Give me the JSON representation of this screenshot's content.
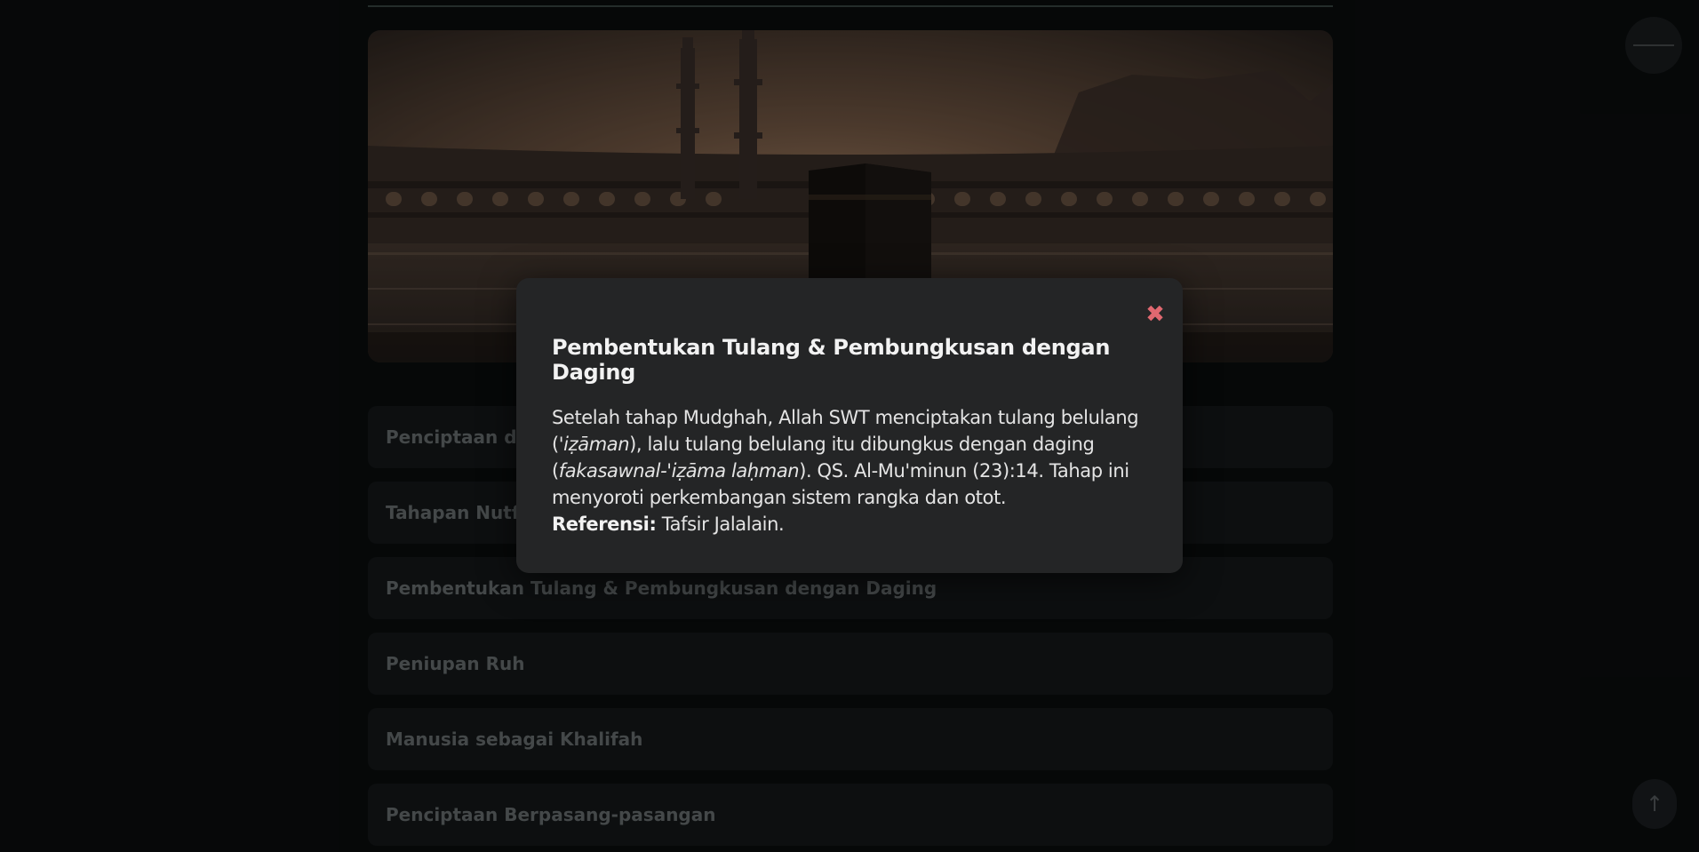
{
  "accordion": {
    "items": [
      {
        "label": "Penciptaan dari Tanah"
      },
      {
        "label": "Tahapan Nutfah, Alaqah & Mudghah"
      },
      {
        "label": "Pembentukan Tulang & Pembungkusan dengan Daging"
      },
      {
        "label": "Peniupan Ruh"
      },
      {
        "label": "Manusia sebagai Khalifah"
      },
      {
        "label": "Penciptaan Berpasang-pasangan"
      }
    ]
  },
  "modal": {
    "close_glyph": "✖",
    "title": "Pembentukan Tulang & Pembungkusan dengan Daging",
    "body_1": "Setelah tahap Mudghah, Allah SWT menciptakan tulang belulang (",
    "term_1": "'iẓāman",
    "body_2": "), lalu tulang belulang itu dibungkus dengan daging (",
    "term_2": "fakasawnal-'iẓāma laḥman",
    "body_3": "). QS. Al-Mu'minun (23):14. Tahap ini menyoroti perkembangan sistem rangka dan otot.",
    "ref_label": "Referensi:",
    "ref_value": " Tafsir Jalalain."
  },
  "buttons": {
    "back_to_top_glyph": "↑"
  },
  "icons": {
    "menu": "hamburger-icon",
    "close": "close-icon",
    "back_to_top": "arrow-up-icon"
  },
  "colors": {
    "background": "#0b0d0e",
    "card": "#15191b",
    "modal": "#242526",
    "close": "#e06870"
  }
}
